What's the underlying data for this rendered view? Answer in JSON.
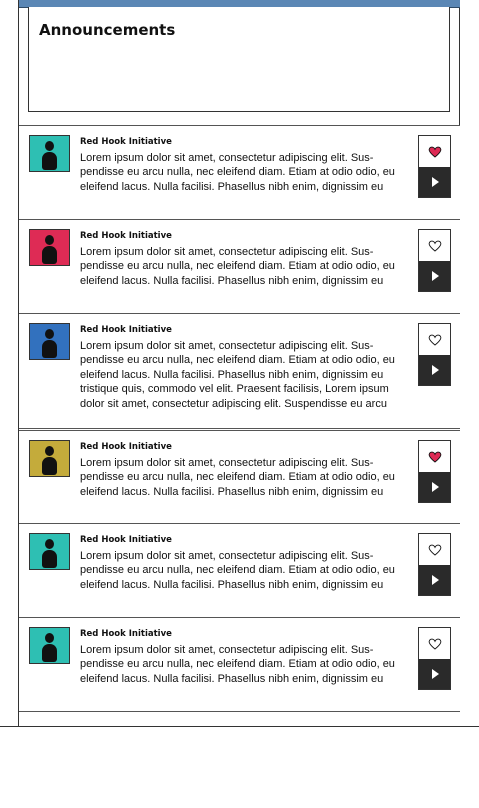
{
  "announcements": {
    "title": "Announcements"
  },
  "items": [
    {
      "author": "Red Hook Initiative",
      "text": "Lorem ipsum dolor sit amet, consectetur adipiscing elit. Sus-pendisse eu arcu nulla, nec eleifend diam. Etiam at odio odio, eu eleifend lacus. Nulla facilisi. Phasellus nibh enim, dignissim eu",
      "avatar_color": "#2ebfb3",
      "liked": true
    },
    {
      "author": "Red Hook Initiative",
      "text": "Lorem ipsum dolor sit amet, consectetur adipiscing elit. Sus-pendisse eu arcu nulla, nec eleifend diam. Etiam at odio odio, eu eleifend lacus. Nulla facilisi. Phasellus nibh enim, dignissim eu",
      "avatar_color": "#de2b55",
      "liked": false
    },
    {
      "author": "Red Hook Initiative",
      "text": "Lorem ipsum dolor sit amet, consectetur adipiscing elit. Sus-pendisse eu arcu nulla, nec eleifend diam. Etiam at odio odio, eu eleifend lacus. Nulla facilisi. Phasellus nibh enim, dignissim eu tristique quis, commodo vel elit. Praesent facilisis, Lorem ipsum dolor sit amet, consectetur adipiscing elit. Suspendisse eu arcu",
      "avatar_color": "#3271be",
      "liked": false
    },
    {
      "author": "Red Hook Initiative",
      "text": "Lorem ipsum dolor sit amet, consectetur adipiscing elit. Sus-pendisse eu arcu nulla, nec eleifend diam. Etiam at odio odio, eu eleifend lacus. Nulla facilisi. Phasellus nibh enim, dignissim eu",
      "avatar_color": "#c4ab3b",
      "liked": true
    },
    {
      "author": "Red Hook Initiative",
      "text": "Lorem ipsum dolor sit amet, consectetur adipiscing elit. Sus-pendisse eu arcu nulla, nec eleifend diam. Etiam at odio odio, eu eleifend lacus. Nulla facilisi. Phasellus nibh enim, dignissim eu",
      "avatar_color": "#2ebfb3",
      "liked": false
    },
    {
      "author": "Red Hook Initiative",
      "text": "Lorem ipsum dolor sit amet, consectetur adipiscing elit. Sus-pendisse eu arcu nulla, nec eleifend diam. Etiam at odio odio, eu eleifend lacus. Nulla facilisi. Phasellus nibh enim, dignissim eu",
      "avatar_color": "#2ebfb3",
      "liked": false
    }
  ],
  "icons": {
    "like": "heart-icon",
    "open": "play-icon",
    "avatar": "person-icon"
  },
  "colors": {
    "heart_liked": "#de2b55",
    "accent_bar": "#5b87b5",
    "play_button": "#2a2a2a"
  }
}
